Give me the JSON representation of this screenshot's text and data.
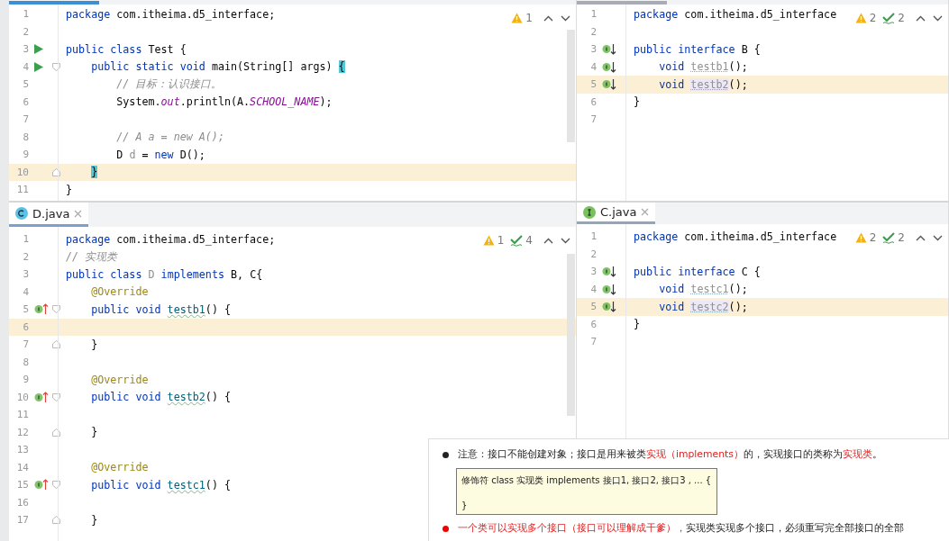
{
  "editors": [
    {
      "inspections": {
        "warnings": "1"
      },
      "lines": [
        {
          "number": "1",
          "current": false,
          "tokens": [
            {
              "kind": "kw",
              "text": "package"
            },
            {
              "kind": "plain",
              "text": " com.itheima.d5_interface;"
            }
          ]
        },
        {
          "number": "2",
          "current": false
        },
        {
          "number": "3",
          "gutter": {
            "kind": "run"
          },
          "current": false,
          "tokens": [
            {
              "kind": "kw",
              "text": "public class"
            },
            {
              "kind": "plain",
              "text": " Test {"
            }
          ]
        },
        {
          "number": "4",
          "gutter": {
            "kind": "run"
          },
          "fold": {
            "kind": "start"
          },
          "current": false,
          "tokens": [
            {
              "kind": "kw",
              "text": "    public static void"
            },
            {
              "kind": "plain",
              "text": " main(String[] args) "
            },
            {
              "kind": "match",
              "text": "{"
            }
          ]
        },
        {
          "number": "5",
          "current": false,
          "tokens": [
            {
              "kind": "comment",
              "text": "        // 目标：认识接口。"
            }
          ]
        },
        {
          "number": "6",
          "current": false,
          "tokens": [
            {
              "kind": "plain",
              "text": "        System."
            },
            {
              "kind": "static",
              "text": "out"
            },
            {
              "kind": "plain",
              "text": ".println(A."
            },
            {
              "kind": "static",
              "text": "SCHOOL_NAME"
            },
            {
              "kind": "plain",
              "text": ");"
            }
          ]
        },
        {
          "number": "7",
          "current": false
        },
        {
          "number": "8",
          "current": false,
          "tokens": [
            {
              "kind": "comment",
              "text": "        // A a = new A();"
            }
          ]
        },
        {
          "number": "9",
          "current": false,
          "tokens": [
            {
              "kind": "plain",
              "text": "        D "
            },
            {
              "kind": "dim",
              "text": "d"
            },
            {
              "kind": "plain",
              "text": " = "
            },
            {
              "kind": "kw",
              "text": "new"
            },
            {
              "kind": "plain",
              "text": " D();"
            }
          ]
        },
        {
          "number": "10",
          "fold": {
            "kind": "end"
          },
          "current": true,
          "tokens": [
            {
              "kind": "match",
              "text": "    }"
            }
          ]
        },
        {
          "number": "11",
          "current": false,
          "tokens": [
            {
              "kind": "plain",
              "text": "}"
            }
          ]
        }
      ]
    },
    {
      "inspections": {
        "warnings": "2",
        "checks": "2"
      },
      "lines": [
        {
          "number": "1",
          "current": false,
          "tokens": [
            {
              "kind": "kw",
              "text": "package"
            },
            {
              "kind": "plain",
              "text": " com.itheima.d5_interface"
            }
          ]
        },
        {
          "number": "2",
          "current": false
        },
        {
          "number": "3",
          "gutter": {
            "kind": "implemented"
          },
          "current": false,
          "tokens": [
            {
              "kind": "kw",
              "text": "public interface"
            },
            {
              "kind": "plain",
              "text": " B {"
            }
          ]
        },
        {
          "number": "4",
          "gutter": {
            "kind": "implemented"
          },
          "current": false,
          "tokens": [
            {
              "kind": "kw",
              "text": "    void"
            },
            {
              "kind": "proto",
              "text": " testb1"
            },
            {
              "kind": "plain",
              "text": "();"
            }
          ]
        },
        {
          "number": "5",
          "gutter": {
            "kind": "implemented"
          },
          "current": true,
          "tokens": [
            {
              "kind": "kw",
              "text": "    void"
            },
            {
              "kind": "proto-found",
              "text": " testb2"
            },
            {
              "kind": "plain",
              "text": "();"
            }
          ]
        },
        {
          "number": "6",
          "current": false,
          "tokens": [
            {
              "kind": "plain",
              "text": "}"
            }
          ]
        },
        {
          "number": "7",
          "current": false
        }
      ]
    },
    {
      "tab": {
        "label": "D.java",
        "kind": "class"
      },
      "inspections": {
        "warnings": "1",
        "checks": "4"
      },
      "lines": [
        {
          "number": "1",
          "current": false,
          "tokens": [
            {
              "kind": "kw",
              "text": "package"
            },
            {
              "kind": "plain",
              "text": " com.itheima.d5_interface;"
            }
          ]
        },
        {
          "number": "2",
          "current": false,
          "tokens": [
            {
              "kind": "comment",
              "text": "// 实现类"
            }
          ]
        },
        {
          "number": "3",
          "current": false,
          "tokens": [
            {
              "kind": "kw",
              "text": "public class"
            },
            {
              "kind": "dim",
              "text": " D"
            },
            {
              "kind": "kw",
              "text": " implements"
            },
            {
              "kind": "plain",
              "text": " B, C{"
            }
          ]
        },
        {
          "number": "4",
          "current": false,
          "tokens": [
            {
              "kind": "ann",
              "text": "    @Override"
            }
          ]
        },
        {
          "number": "5",
          "gutter": {
            "kind": "implementing"
          },
          "fold": {
            "kind": "start"
          },
          "current": false,
          "tokens": [
            {
              "kind": "kw",
              "text": "    public void"
            },
            {
              "kind": "fn",
              "text": " testb1"
            },
            {
              "kind": "plain",
              "text": "() {"
            }
          ]
        },
        {
          "number": "6",
          "current": true
        },
        {
          "number": "7",
          "fold": {
            "kind": "end"
          },
          "current": false,
          "tokens": [
            {
              "kind": "plain",
              "text": "    }"
            }
          ]
        },
        {
          "number": "8",
          "current": false
        },
        {
          "number": "9",
          "current": false,
          "tokens": [
            {
              "kind": "ann",
              "text": "    @Override"
            }
          ]
        },
        {
          "number": "10",
          "gutter": {
            "kind": "implementing"
          },
          "fold": {
            "kind": "start"
          },
          "current": false,
          "tokens": [
            {
              "kind": "kw",
              "text": "    public void"
            },
            {
              "kind": "fn",
              "text": " testb2"
            },
            {
              "kind": "plain",
              "text": "() {"
            }
          ]
        },
        {
          "number": "11",
          "current": false
        },
        {
          "number": "12",
          "fold": {
            "kind": "end"
          },
          "current": false,
          "tokens": [
            {
              "kind": "plain",
              "text": "    }"
            }
          ]
        },
        {
          "number": "13",
          "current": false
        },
        {
          "number": "14",
          "current": false,
          "tokens": [
            {
              "kind": "ann",
              "text": "    @Override"
            }
          ]
        },
        {
          "number": "15",
          "gutter": {
            "kind": "implementing"
          },
          "fold": {
            "kind": "start"
          },
          "current": false,
          "tokens": [
            {
              "kind": "kw",
              "text": "    public void"
            },
            {
              "kind": "fn",
              "text": " testc1"
            },
            {
              "kind": "plain",
              "text": "() {"
            }
          ]
        },
        {
          "number": "16",
          "current": false
        },
        {
          "number": "17",
          "fold": {
            "kind": "end"
          },
          "current": false,
          "tokens": [
            {
              "kind": "plain",
              "text": "    }"
            }
          ]
        }
      ]
    },
    {
      "tab": {
        "label": "C.java",
        "kind": "interface"
      },
      "inspections": {
        "warnings": "2",
        "checks": "2"
      },
      "lines": [
        {
          "number": "1",
          "current": false,
          "tokens": [
            {
              "kind": "kw",
              "text": "package"
            },
            {
              "kind": "plain",
              "text": " com.itheima.d5_interface"
            }
          ]
        },
        {
          "number": "2",
          "current": false
        },
        {
          "number": "3",
          "gutter": {
            "kind": "implemented"
          },
          "current": false,
          "tokens": [
            {
              "kind": "kw",
              "text": "public interface"
            },
            {
              "kind": "plain",
              "text": " C {"
            }
          ]
        },
        {
          "number": "4",
          "gutter": {
            "kind": "implemented"
          },
          "current": false,
          "tokens": [
            {
              "kind": "kw",
              "text": "    void"
            },
            {
              "kind": "proto",
              "text": " testc1"
            },
            {
              "kind": "plain",
              "text": "();"
            }
          ]
        },
        {
          "number": "5",
          "gutter": {
            "kind": "implemented"
          },
          "current": true,
          "tokens": [
            {
              "kind": "kw",
              "text": "    void"
            },
            {
              "kind": "proto-found",
              "text": " testc2"
            },
            {
              "kind": "plain",
              "text": "();"
            }
          ]
        },
        {
          "number": "6",
          "current": false,
          "tokens": [
            {
              "kind": "plain",
              "text": "}"
            }
          ]
        },
        {
          "number": "7",
          "current": false
        }
      ]
    }
  ],
  "slide": {
    "bullets": [
      {
        "kind": "note",
        "segments": [
          {
            "text": "注意：接口不能创建对象；接口是用来被类",
            "emphasis": false
          },
          {
            "text": "实现（implements）",
            "emphasis": true
          },
          {
            "text": "的，实现接口的类称为",
            "emphasis": false
          },
          {
            "text": "实现类",
            "emphasis": true
          },
          {
            "text": "。",
            "emphasis": false
          }
        ],
        "code": [
          "修饰符 class 实现类 implements 接口1, 接口2, 接口3 , ... {",
          "}"
        ]
      },
      {
        "kind": "key",
        "segments": [
          {
            "text": "一个类可以实现多个接口（接口可以理解成干爹），",
            "emphasis": true
          },
          {
            "text": "实现类实现多个接口，必须重写完全部接口的全部",
            "emphasis": false
          }
        ]
      }
    ]
  }
}
